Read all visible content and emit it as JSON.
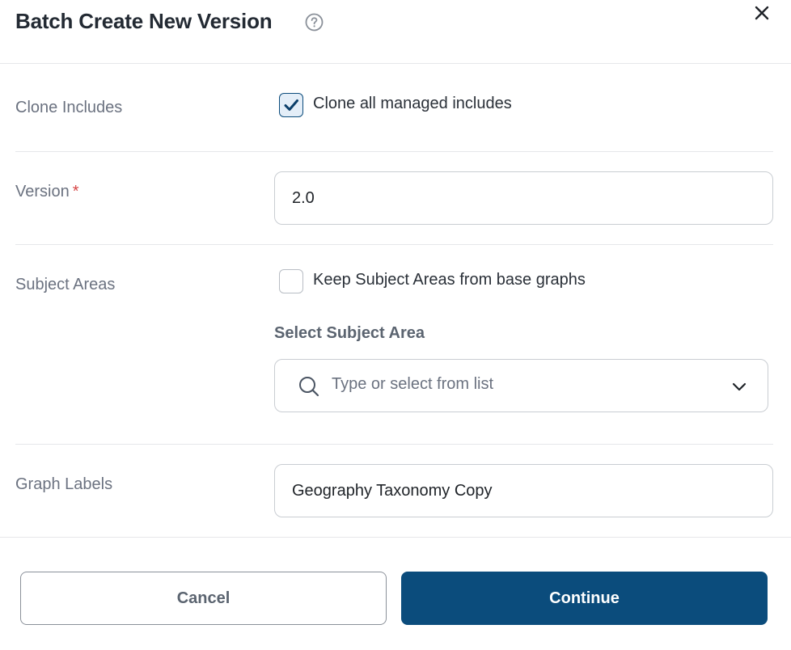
{
  "dialog": {
    "title": "Batch Create New Version",
    "help_icon": "question-circle-icon",
    "close_icon": "close-icon"
  },
  "clone_includes": {
    "label": "Clone Includes",
    "checkbox_label": "Clone all managed includes",
    "checked": true
  },
  "version": {
    "label": "Version",
    "required_marker": "*",
    "value": "2.0"
  },
  "subject_areas": {
    "label": "Subject Areas",
    "checkbox_label": "Keep Subject Areas from base graphs",
    "checked": false,
    "select_label": "Select Subject Area",
    "select_placeholder": "Type or select from list",
    "search_icon": "search-icon",
    "dropdown_icon": "chevron-down-icon"
  },
  "graph_labels": {
    "label": "Graph Labels",
    "value": "Geography Taxonomy Copy"
  },
  "footer": {
    "cancel_label": "Cancel",
    "continue_label": "Continue"
  },
  "colors": {
    "primary": "#0b4c7c",
    "required": "#d64545",
    "label_gray": "#6b7280"
  }
}
